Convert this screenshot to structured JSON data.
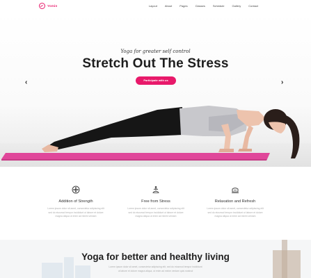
{
  "brand": {
    "name": "Yomin",
    "accent": "#e8196a"
  },
  "nav": {
    "items": [
      "Layout",
      "About",
      "Pages",
      "Classes",
      "Schedule",
      "Gallery",
      "Contact"
    ]
  },
  "hero": {
    "subtitle": "Yoga for greater self control",
    "title": "Stretch Out The Stress",
    "cta_label": "Participate with us",
    "prev_icon": "chevron-left-icon",
    "next_icon": "chevron-right-icon"
  },
  "features": [
    {
      "icon": "flower-icon",
      "title": "Addition of Strength",
      "lines": [
        "Lorem ipsum dolor sit amet, consectetur adipiscing elit",
        "sed do eiusmod tempor incididunt ut labore et dolore",
        "magna aliqua ut enim ad minim veniam"
      ]
    },
    {
      "icon": "meditation-icon",
      "title": "Free from Stress",
      "lines": [
        "Lorem ipsum dolor sit amet, consectetur adipiscing elit",
        "sed do eiusmod tempor incididunt ut labore et dolore",
        "magna aliqua ut enim ad minim veniam"
      ]
    },
    {
      "icon": "relaxation-icon",
      "title": "Relaxation and Refresh",
      "lines": [
        "Lorem ipsum dolor sit amet, consectetur adipiscing elit",
        "sed do eiusmod tempor incididunt ut labore et dolore",
        "magna aliqua ut enim ad minim veniam"
      ]
    }
  ],
  "section": {
    "title": "Yoga for better and healthy living",
    "lines": [
      "Lorem ipsum dolor sit amet, consectetur adipiscing elit, sed do eiusmod tempor incididunt",
      "ut labore et dolore magna aliqua, ut enim ad minim veniam quis nostrud"
    ]
  }
}
